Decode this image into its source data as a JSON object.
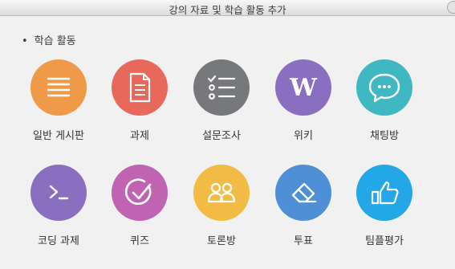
{
  "window": {
    "title": "강의 자료 및 학습 활동 추가"
  },
  "section": {
    "bullet": "•",
    "title": "학습 활동"
  },
  "activities": [
    {
      "label": "일반 게시판",
      "icon": "list-icon",
      "color": "#ef9a48"
    },
    {
      "label": "과제",
      "icon": "document-icon",
      "color": "#e8695c"
    },
    {
      "label": "설문조사",
      "icon": "checklist-icon",
      "color": "#77787b"
    },
    {
      "label": "위키",
      "icon": "wiki-icon",
      "color": "#8a6fc0"
    },
    {
      "label": "채팅방",
      "icon": "chat-icon",
      "color": "#3fb8c2"
    },
    {
      "label": "코딩 과제",
      "icon": "terminal-icon",
      "color": "#8a6fc0"
    },
    {
      "label": "퀴즈",
      "icon": "check-circle-icon",
      "color": "#c063b3"
    },
    {
      "label": "토론방",
      "icon": "people-icon",
      "color": "#f2bb44"
    },
    {
      "label": "투표",
      "icon": "eraser-icon",
      "color": "#4f8fd6"
    },
    {
      "label": "팀플평가",
      "icon": "thumbs-up-icon",
      "color": "#23a7e8"
    }
  ]
}
